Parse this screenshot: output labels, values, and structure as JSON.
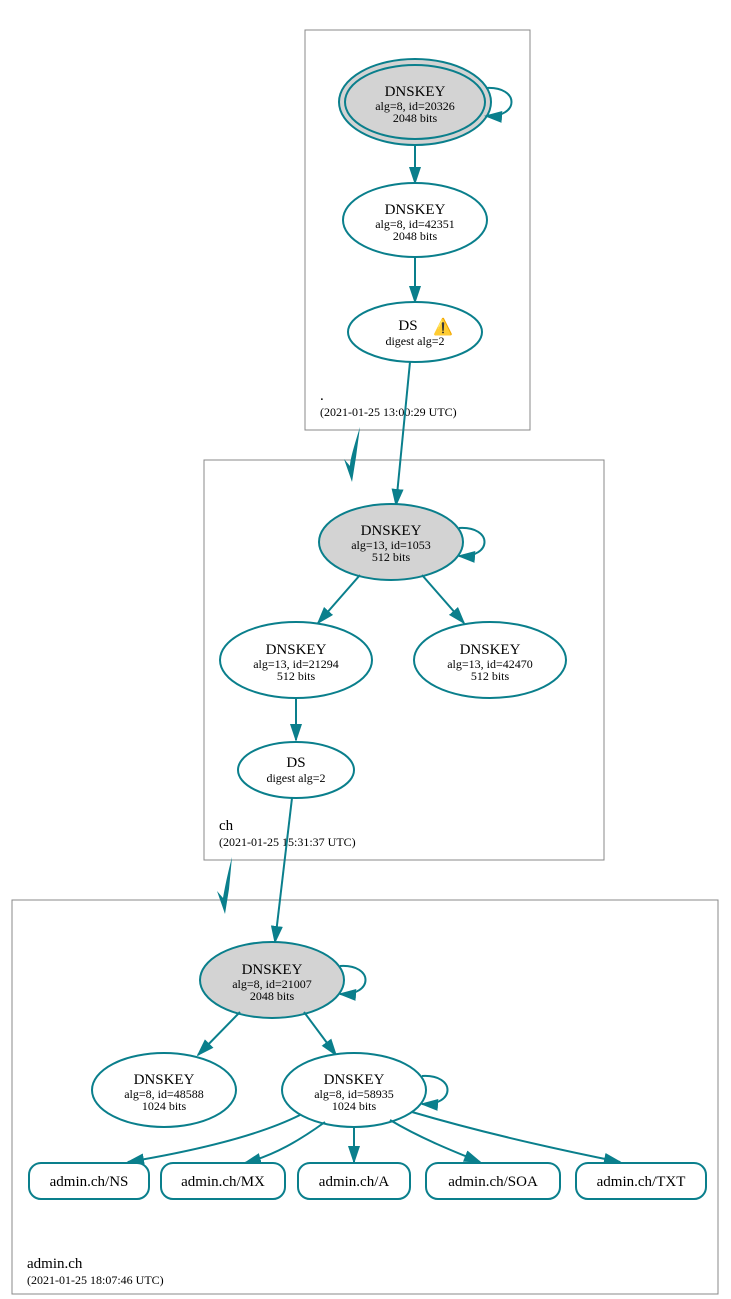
{
  "zones": [
    {
      "name": ".",
      "ts": "(2021-01-25 13:00:29 UTC)"
    },
    {
      "name": "ch",
      "ts": "(2021-01-25 15:31:37 UTC)"
    },
    {
      "name": "admin.ch",
      "ts": "(2021-01-25 18:07:46 UTC)"
    }
  ],
  "nodes": {
    "root_ksk": {
      "title": "DNSKEY",
      "l1": "alg=8, id=20326",
      "l2": "2048 bits"
    },
    "root_zsk": {
      "title": "DNSKEY",
      "l1": "alg=8, id=42351",
      "l2": "2048 bits"
    },
    "root_ds": {
      "title": "DS",
      "l1": "digest alg=2",
      "warn": "⚠️"
    },
    "ch_ksk": {
      "title": "DNSKEY",
      "l1": "alg=13, id=1053",
      "l2": "512 bits"
    },
    "ch_zsk1": {
      "title": "DNSKEY",
      "l1": "alg=13, id=21294",
      "l2": "512 bits"
    },
    "ch_zsk2": {
      "title": "DNSKEY",
      "l1": "alg=13, id=42470",
      "l2": "512 bits"
    },
    "ch_ds": {
      "title": "DS",
      "l1": "digest alg=2"
    },
    "ad_ksk": {
      "title": "DNSKEY",
      "l1": "alg=8, id=21007",
      "l2": "2048 bits"
    },
    "ad_zsk1": {
      "title": "DNSKEY",
      "l1": "alg=8, id=48588",
      "l2": "1024 bits"
    },
    "ad_zsk2": {
      "title": "DNSKEY",
      "l1": "alg=8, id=58935",
      "l2": "1024 bits"
    }
  },
  "rr": [
    "admin.ch/NS",
    "admin.ch/MX",
    "admin.ch/A",
    "admin.ch/SOA",
    "admin.ch/TXT"
  ]
}
